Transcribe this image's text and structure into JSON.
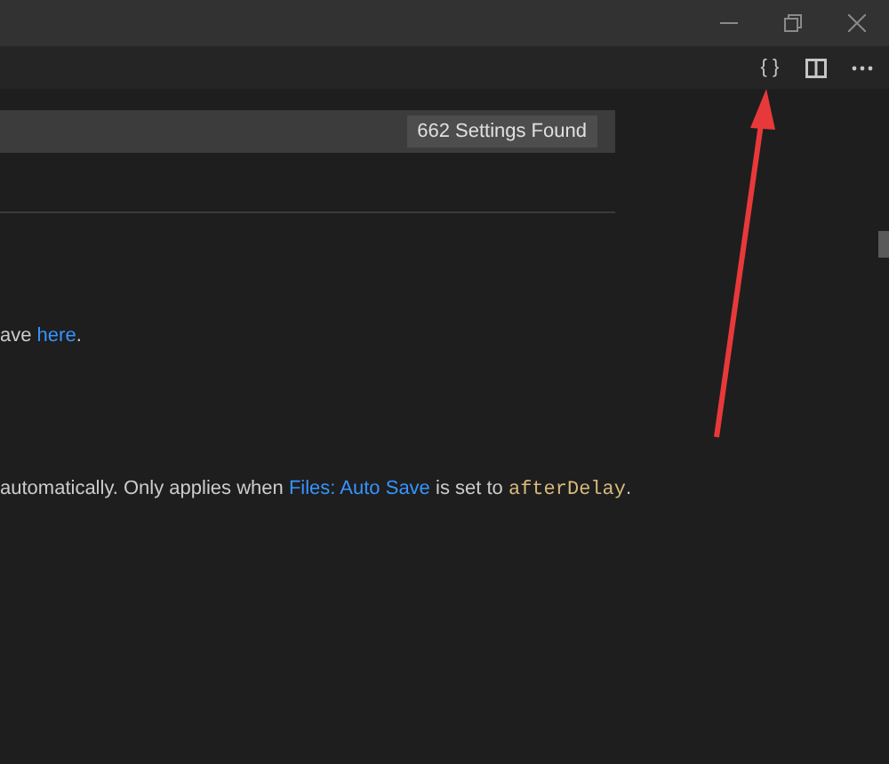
{
  "toolbar": {
    "json_button": "{ }"
  },
  "search": {
    "badge": "662 Settings Found"
  },
  "settings": [
    {
      "before": "ave ",
      "link": "here",
      "after": "."
    },
    {
      "before": "automatically. Only applies when ",
      "link": "Files: Auto Save",
      "after": " is set to ",
      "code": "afterDelay",
      "end": "."
    }
  ]
}
